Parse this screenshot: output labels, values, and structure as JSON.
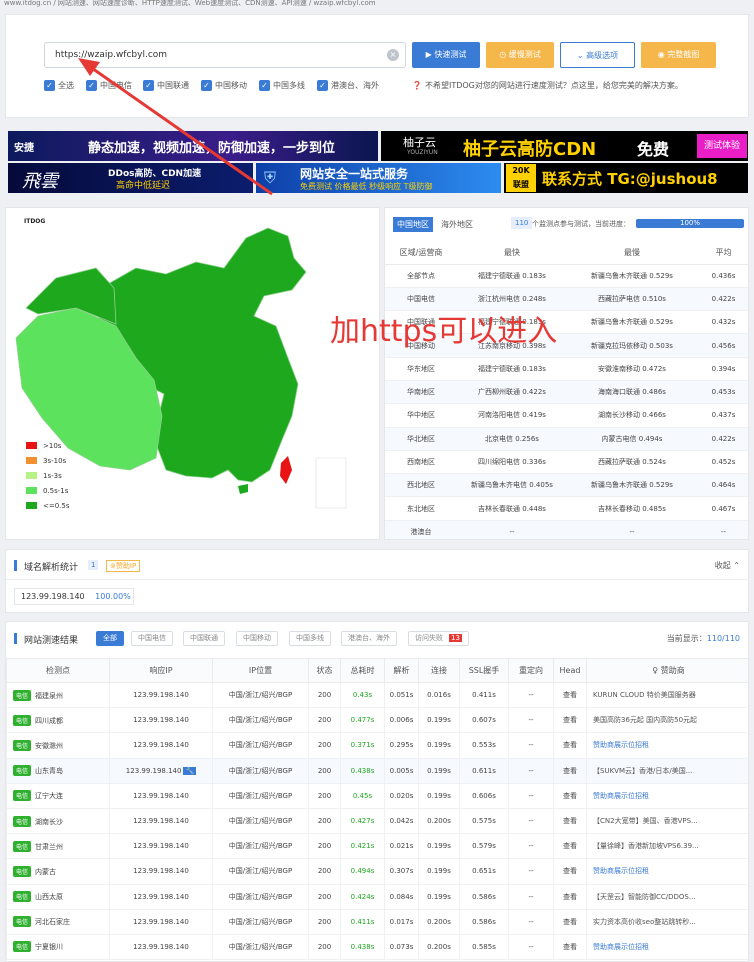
{
  "breadcrumb": "www.itdog.cn / 网站测速、网站速度诊断、HTTP速度测试、Web速度测试、CDN测速、API测速 / wzaip.wfcbyl.com",
  "search": {
    "url": "https://wzaip.wfcbyl.com",
    "clear_icon": "×"
  },
  "buttons": {
    "fast": "快速测试",
    "slow": "缓慢测试",
    "advanced": "高级选项",
    "shot": "完整截图"
  },
  "filters": [
    "全选",
    "中国电信",
    "中国联通",
    "中国移动",
    "中国多线",
    "港澳台、海外"
  ],
  "tip": "不希望ITDOG对您的网站进行速度测试？点这里，给您完美的解决方案。",
  "ads": {
    "a1": {
      "logo": "安捷",
      "text": "静态加速，视频加速，防御加速，一步到位"
    },
    "a2": {
      "logo": "柚子云",
      "sub": "YOUZIYUN",
      "text": "柚子云高防CDN",
      "free": "免费",
      "trial": "测试体验"
    },
    "a3": {
      "logo": "飛雲",
      "l1": "DDos高防、CDN加速",
      "l2": "高命中低延迟"
    },
    "a4": {
      "t1": "网站安全一站式服务",
      "t2": "免费测试 价格最低 秒级响应 T级防御"
    },
    "a5": {
      "badge1": "20K",
      "badge2": "联盟",
      "text": "联系方式 TG:@jushou8"
    }
  },
  "map": {
    "logo": "ITDOG",
    "legend": [
      {
        "label": ">10s",
        "color": "#e81313"
      },
      {
        "label": "3s-10s",
        "color": "#f28f2e"
      },
      {
        "label": "1s-3s",
        "color": "#b6f287"
      },
      {
        "label": "0.5s-1s",
        "color": "#5ce25c"
      },
      {
        "label": "<=0.5s",
        "color": "#1ea81e"
      }
    ]
  },
  "region": {
    "tabs": [
      "中国地区",
      "海外地区"
    ],
    "count": "110",
    "count_text": "个监测点参与测试，当前进度：",
    "progress_text": "100%",
    "progress": 1.0,
    "headers": [
      "区域/运营商",
      "最快",
      "最慢",
      "平均"
    ],
    "rows": [
      [
        "全部节点",
        "福建宁德联通 0.183s",
        "新疆乌鲁木齐联通 0.529s",
        "0.436s"
      ],
      [
        "中国电信",
        "浙江杭州电信 0.248s",
        "西藏拉萨电信 0.510s",
        "0.422s"
      ],
      [
        "中国联通",
        "福建宁德联通 0.183s",
        "新疆乌鲁木齐联通 0.529s",
        "0.432s"
      ],
      [
        "中国移动",
        "江苏南京移动 0.398s",
        "新疆克拉玛依移动 0.503s",
        "0.456s"
      ],
      [
        "华东地区",
        "福建宁德联通 0.183s",
        "安徽淮南移动 0.472s",
        "0.394s"
      ],
      [
        "华南地区",
        "广西柳州联通 0.422s",
        "海南海口联通 0.486s",
        "0.453s"
      ],
      [
        "华中地区",
        "河南洛阳电信 0.419s",
        "湖南长沙移动 0.466s",
        "0.437s"
      ],
      [
        "华北地区",
        "北京电信 0.256s",
        "内蒙古电信 0.494s",
        "0.422s"
      ],
      [
        "西南地区",
        "四川绵阳电信 0.336s",
        "西藏拉萨联通 0.524s",
        "0.452s"
      ],
      [
        "西北地区",
        "新疆乌鲁木齐电信 0.405s",
        "新疆乌鲁木齐联通 0.529s",
        "0.464s"
      ],
      [
        "东北地区",
        "吉林长春联通 0.448s",
        "吉林长春移动 0.485s",
        "0.467s"
      ],
      [
        "港澳台",
        "--",
        "--",
        "--"
      ]
    ]
  },
  "annotation": "加https可以进入",
  "dns": {
    "title": "域名解析统计",
    "count": "1",
    "badge": "赞助IP",
    "collapse": "收起",
    "ip": "123.99.198.140",
    "percent": "100.00%"
  },
  "results": {
    "title": "网站测速结果",
    "tabs": [
      "全部",
      "中国电信",
      "中国联通",
      "中国移动",
      "中国多线",
      "港澳台、海外",
      "访问失败"
    ],
    "fail_count": "13",
    "showing_label": "当前显示：",
    "showing": "110/110",
    "headers": [
      "检测点",
      "响应IP",
      "IP位置",
      "状态",
      "总耗时",
      "解析",
      "连接",
      "SSL握手",
      "重定向",
      "Head",
      "赞助商"
    ],
    "rows": [
      {
        "isp": "电信",
        "node": "福建泉州",
        "ip": "123.99.198.140",
        "loc": "中国/浙江/绍兴/BGP",
        "status": "200",
        "total": "0.43s",
        "dns": "0.051s",
        "conn": "0.016s",
        "ssl": "0.411s",
        "redir": "--",
        "head": "查看",
        "sponsor": "KURUN CLOUD 特价美国服务器",
        "link": false
      },
      {
        "isp": "电信",
        "node": "四川成都",
        "ip": "123.99.198.140",
        "loc": "中国/浙江/绍兴/BGP",
        "status": "200",
        "total": "0.477s",
        "dns": "0.006s",
        "conn": "0.199s",
        "ssl": "0.607s",
        "redir": "--",
        "head": "查看",
        "sponsor": "美国高防36元起 国内高防50元起",
        "link": false
      },
      {
        "isp": "电信",
        "node": "安徽滁州",
        "ip": "123.99.198.140",
        "loc": "中国/浙江/绍兴/BGP",
        "status": "200",
        "total": "0.371s",
        "dns": "0.295s",
        "conn": "0.199s",
        "ssl": "0.553s",
        "redir": "--",
        "head": "查看",
        "sponsor": "赞助商展示位招租",
        "link": true
      },
      {
        "isp": "电信",
        "node": "山东青岛",
        "ip": "123.99.198.140",
        "loc": "中国/浙江/绍兴/BGP",
        "status": "200",
        "total": "0.438s",
        "dns": "0.005s",
        "conn": "0.199s",
        "ssl": "0.611s",
        "redir": "--",
        "head": "查看",
        "sponsor": "【SUKVM云】香港/日本/美国...",
        "link": false
      },
      {
        "isp": "电信",
        "node": "辽宁大连",
        "ip": "123.99.198.140",
        "loc": "中国/浙江/绍兴/BGP",
        "status": "200",
        "total": "0.45s",
        "dns": "0.020s",
        "conn": "0.199s",
        "ssl": "0.606s",
        "redir": "--",
        "head": "查看",
        "sponsor": "赞助商展示位招租",
        "link": true
      },
      {
        "isp": "电信",
        "node": "湖南长沙",
        "ip": "123.99.198.140",
        "loc": "中国/浙江/绍兴/BGP",
        "status": "200",
        "total": "0.427s",
        "dns": "0.042s",
        "conn": "0.200s",
        "ssl": "0.575s",
        "redir": "--",
        "head": "查看",
        "sponsor": "【CN2大宽带】美国、香港VPS...",
        "link": false
      },
      {
        "isp": "电信",
        "node": "甘肃兰州",
        "ip": "123.99.198.140",
        "loc": "中国/浙江/绍兴/BGP",
        "status": "200",
        "total": "0.421s",
        "dns": "0.021s",
        "conn": "0.199s",
        "ssl": "0.579s",
        "redir": "--",
        "head": "查看",
        "sponsor": "【量徐峰】香港新加坡VPS6.39...",
        "link": false
      },
      {
        "isp": "电信",
        "node": "内蒙古",
        "ip": "123.99.198.140",
        "loc": "中国/浙江/绍兴/BGP",
        "status": "200",
        "total": "0.494s",
        "dns": "0.307s",
        "conn": "0.199s",
        "ssl": "0.651s",
        "redir": "--",
        "head": "查看",
        "sponsor": "赞助商展示位招租",
        "link": true
      },
      {
        "isp": "电信",
        "node": "山西太原",
        "ip": "123.99.198.140",
        "loc": "中国/浙江/绍兴/BGP",
        "status": "200",
        "total": "0.424s",
        "dns": "0.084s",
        "conn": "0.199s",
        "ssl": "0.586s",
        "redir": "--",
        "head": "查看",
        "sponsor": "【天罡云】智能防御CC/DDOS...",
        "link": false
      },
      {
        "isp": "电信",
        "node": "河北石家庄",
        "ip": "123.99.198.140",
        "loc": "中国/浙江/绍兴/BGP",
        "status": "200",
        "total": "0.411s",
        "dns": "0.017s",
        "conn": "0.200s",
        "ssl": "0.586s",
        "redir": "--",
        "head": "查看",
        "sponsor": "实力资本高价收seo整站跳转秒...",
        "link": false
      },
      {
        "isp": "电信",
        "node": "宁夏银川",
        "ip": "123.99.198.140",
        "loc": "中国/浙江/绍兴/BGP",
        "status": "200",
        "total": "0.438s",
        "dns": "0.073s",
        "conn": "0.200s",
        "ssl": "0.585s",
        "redir": "--",
        "head": "查看",
        "sponsor": "赞助商展示位招租",
        "link": true
      }
    ]
  },
  "colors": {
    "primary": "#3a7bd5",
    "orange": "#f5b64a",
    "green": "#1ea81e",
    "red": "#e53935"
  }
}
